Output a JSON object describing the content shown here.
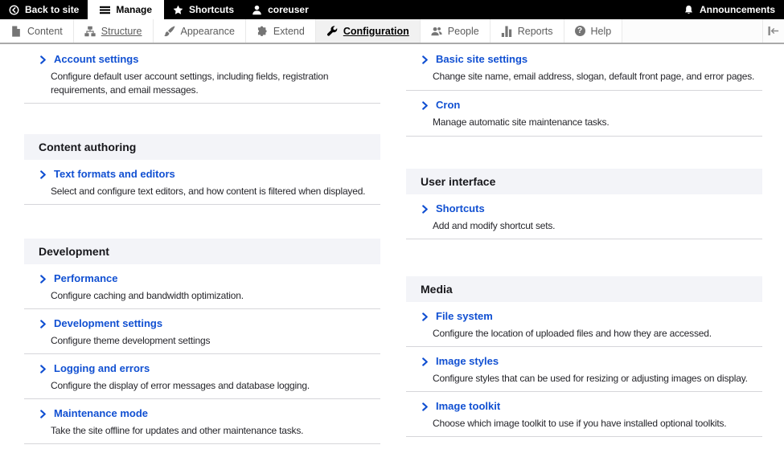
{
  "topbar": {
    "back": "Back to site",
    "manage": "Manage",
    "shortcuts": "Shortcuts",
    "user": "coreuser",
    "announcements": "Announcements",
    "icons": [
      "back-icon",
      "hamburger-icon",
      "star-icon",
      "user-icon",
      "bell-icon"
    ]
  },
  "tray": {
    "items": [
      {
        "label": "Content",
        "icon": "document-icon"
      },
      {
        "label": "Structure",
        "icon": "sitemap-icon",
        "underlined": true
      },
      {
        "label": "Appearance",
        "icon": "paintbrush-icon"
      },
      {
        "label": "Extend",
        "icon": "puzzle-icon"
      },
      {
        "label": "Configuration",
        "icon": "wrench-icon",
        "active": true
      },
      {
        "label": "People",
        "icon": "people-icon"
      },
      {
        "label": "Reports",
        "icon": "bar-chart-icon"
      },
      {
        "label": "Help",
        "icon": "question-icon"
      }
    ],
    "orientation_toggle_icon": "vertical-orientation-icon"
  },
  "colors": {
    "link_blue": "#1150d2",
    "panel_header_bg": "#f3f4f8",
    "topbar_bg": "#000000",
    "active_tray_bg": "#f1f1f1"
  },
  "panels": {
    "left": [
      {
        "header": null,
        "items": [
          {
            "title": "Account settings",
            "description": "Configure default user account settings, including fields, registration requirements, and email messages."
          }
        ]
      },
      {
        "header": "Content authoring",
        "items": [
          {
            "title": "Text formats and editors",
            "description": "Select and configure text editors, and how content is filtered when displayed."
          }
        ]
      },
      {
        "header": "Development",
        "items": [
          {
            "title": "Performance",
            "description": "Configure caching and bandwidth optimization."
          },
          {
            "title": "Development settings",
            "description": "Configure theme development settings"
          },
          {
            "title": "Logging and errors",
            "description": "Configure the display of error messages and database logging."
          },
          {
            "title": "Maintenance mode",
            "description": "Take the site offline for updates and other maintenance tasks."
          }
        ]
      }
    ],
    "right": [
      {
        "header": null,
        "items": [
          {
            "title": "Basic site settings",
            "description": "Change site name, email address, slogan, default front page, and error pages."
          },
          {
            "title": "Cron",
            "description": "Manage automatic site maintenance tasks."
          }
        ]
      },
      {
        "header": "User interface",
        "items": [
          {
            "title": "Shortcuts",
            "description": "Add and modify shortcut sets."
          }
        ]
      },
      {
        "header": "Media",
        "items": [
          {
            "title": "File system",
            "description": "Configure the location of uploaded files and how they are accessed."
          },
          {
            "title": "Image styles",
            "description": "Configure styles that can be used for resizing or adjusting images on display."
          },
          {
            "title": "Image toolkit",
            "description": "Choose which image toolkit to use if you have installed optional toolkits."
          }
        ]
      }
    ]
  }
}
